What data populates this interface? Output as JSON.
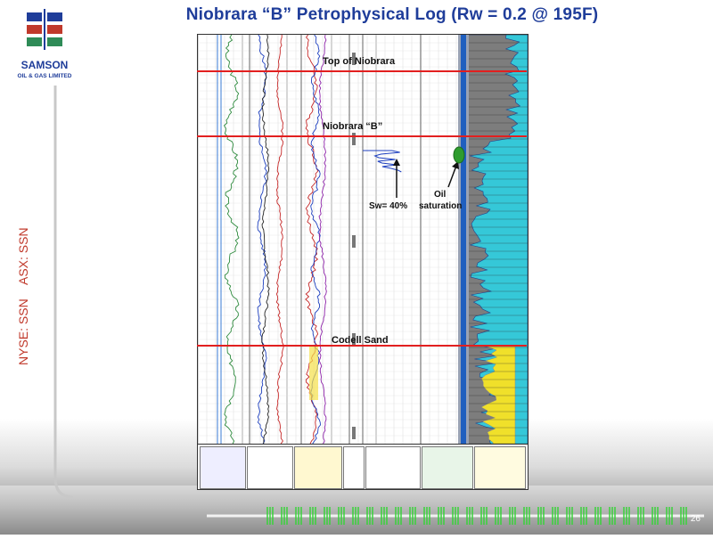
{
  "title": "Niobrara “B” Petrophysical Log (Rw = 0.2 @ 195F)",
  "logo": {
    "name": "SAMSON",
    "subtitle": "OIL & GAS LIMITED"
  },
  "tickers": [
    "NYSE: SSN",
    "ASX: SSN"
  ],
  "annotations": {
    "top_niobrara": "Top of Niobrara",
    "niobrara_b": "Niobrara “B”",
    "codell": "Codell Sand",
    "oil_saturation_1": "Oil",
    "oil_saturation_2": "saturation",
    "sw": "Sw= 40%"
  },
  "page_number": "26",
  "colors": {
    "title": "#1f3d9a",
    "accent_red": "#e21f1f",
    "oil": "#2e9c2e"
  }
}
